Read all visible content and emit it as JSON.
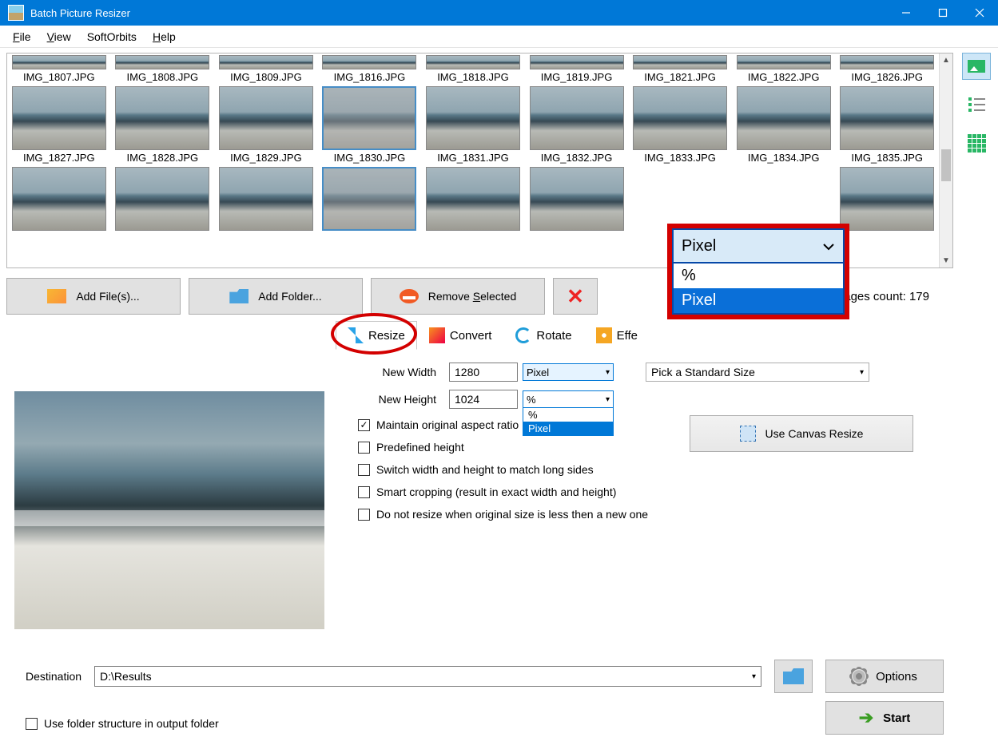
{
  "titlebar": {
    "title": "Batch Picture Resizer"
  },
  "menubar": {
    "file": "File",
    "file_ul": "F",
    "view": "View",
    "view_ul": "V",
    "softorbits": "SoftOrbits",
    "help": "Help",
    "help_ul": "H"
  },
  "thumbnails": {
    "row0": [
      "IMG_1807.JPG",
      "IMG_1808.JPG",
      "IMG_1809.JPG",
      "IMG_1816.JPG",
      "IMG_1818.JPG",
      "IMG_1819.JPG",
      "IMG_1821.JPG",
      "IMG_1822.JPG",
      "IMG_1826.JPG"
    ],
    "row1": [
      "IMG_1827.JPG",
      "IMG_1828.JPG",
      "IMG_1829.JPG",
      "IMG_1830.JPG",
      "IMG_1831.JPG",
      "IMG_1832.JPG",
      "IMG_1833.JPG",
      "IMG_1834.JPG",
      "IMG_1835.JPG"
    ],
    "selected_index_row1": 3
  },
  "actions": {
    "add_files": "Add File(s)...",
    "add_folder": "Add Folder...",
    "remove_selected": "Remove Selected",
    "images_count": "Images count: 179"
  },
  "tabs": {
    "resize": "Resize",
    "convert": "Convert",
    "rotate": "Rotate",
    "effects": "Effe"
  },
  "resize": {
    "new_width_label": "New Width",
    "new_width_value": "1280",
    "new_height_label": "New Height",
    "new_height_value": "1024",
    "unit_selected": "Pixel",
    "unit_options": {
      "percent": "%",
      "pixel": "Pixel"
    },
    "maintain_aspect": "Maintain original aspect ratio",
    "predefined_height": "Predefined height",
    "switch_wh": "Switch width and height to match long sides",
    "smart_crop": "Smart cropping (result in exact width and height)",
    "do_not_resize": "Do not resize when original size is less then a new one",
    "standard_size": "Pick a Standard Size",
    "use_canvas": "Use Canvas Resize"
  },
  "zoom": {
    "selected": "Pixel",
    "opt_percent": "%",
    "opt_pixel": "Pixel"
  },
  "bottom": {
    "destination_label": "Destination",
    "destination_value": "D:\\Results",
    "use_folder_structure": "Use folder structure in output folder",
    "options": "Options",
    "start": "Start"
  }
}
